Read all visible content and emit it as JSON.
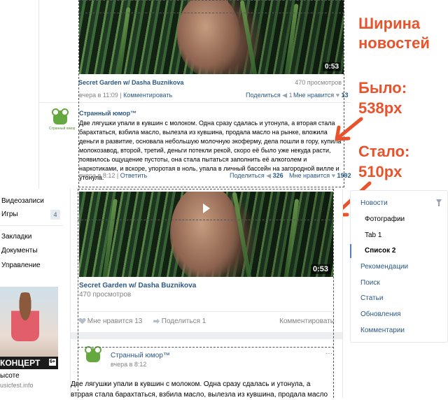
{
  "old_layout": {
    "video": {
      "duration": "0:53",
      "title": "Secret Garden w/ Dasha Buznikova",
      "views": "470 просмотров",
      "date": "вчера в 11:09",
      "comment": "Комментировать",
      "share_label": "Поделиться",
      "share_count": "1",
      "like_label": "Мне нравится",
      "like_count": "13"
    },
    "post": {
      "author": "Странный юмор™",
      "avatar_caption": "Странный юмор",
      "text": "Две лягушки упали в кувшин с молоком. Одна сразу сдалась и утонула, а вторая стала барахтаться, взбила масло, вылезла из кувшина, продала масло на рынке, вложила деньги в развитие, основала небольшую молочную экоферму, дела пошли в гору, купила молокозавод, второй, третий, деньги потекли рекой, скоро её было уже некуда расти, появилось ощущение пустоты, она стала пытаться заполнить её алкоголем и наркотиками, и вскоре, упоротая в ноль, упала в личный бассейн на загородной вилле и утонула.",
      "date": "вчера в 8:12",
      "reply": "Ответить",
      "share_label": "Поделиться",
      "share_count": "326",
      "like_label": "Мне нравится",
      "like_count": "1992"
    }
  },
  "annotation": {
    "line1": "Ширина",
    "line2": "новостей",
    "before_label": "Было:",
    "before_value": "538px",
    "after_label": "Стало:",
    "after_value": "510px",
    "color": "#e8532c"
  },
  "left_nav": {
    "items": [
      "Видеозаписи",
      "Игры",
      "Закладки",
      "Документы",
      "Управление"
    ],
    "games_badge": "4",
    "ad": {
      "banner": "КОНЦЕРТ",
      "age": "6+",
      "title": "ысоте",
      "domain": "usicfest.info"
    }
  },
  "new_layout": {
    "video": {
      "duration": "0:53",
      "title": "Secret Garden w/ Dasha Buznikova",
      "views": "470 просмотров",
      "like_label": "Мне нравится",
      "like_count": "13",
      "share_label": "Поделиться",
      "share_count": "1",
      "comment": "Комментировать"
    },
    "post": {
      "author": "Странный юмор™",
      "date": "вчера в 8:12",
      "more": "···",
      "text_line1": "Две лягушки упали в кувшин с молоком. Одна сразу сдалась и утонула, а",
      "text_line2": "вторая стала барахтаться, взбила масло, вылезла из кувшина, продала масло"
    }
  },
  "right_nav": {
    "items": [
      "Новости",
      "Фотографии",
      "Tab 1",
      "Список 2",
      "Рекомендации",
      "Поиск",
      "Статьи",
      "Обновления",
      "Комментарии"
    ],
    "active": "Список 2"
  }
}
